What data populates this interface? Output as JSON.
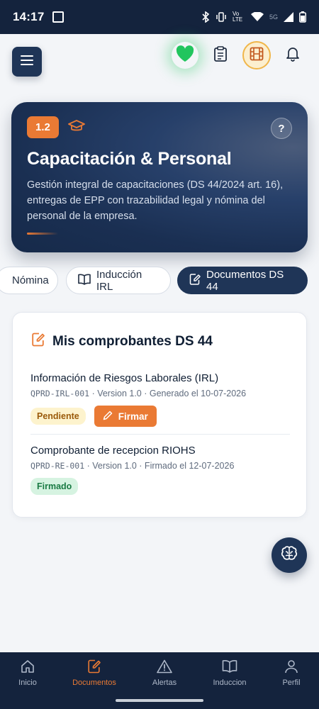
{
  "status_bar": {
    "time": "14:17",
    "network_labels": [
      "Vo LTE",
      "5G"
    ]
  },
  "hero": {
    "badge": "1.2",
    "help": "?",
    "title": "Capacitación & Personal",
    "description": "Gestión integral de capacitaciones (DS 44/2024 art. 16), entregas de EPP con trazabilidad legal y nómina del personal de la empresa."
  },
  "tabs": [
    {
      "label": "Nómina"
    },
    {
      "label": "Inducción IRL"
    },
    {
      "label": "Documentos DS 44",
      "active": true
    }
  ],
  "card": {
    "title": "Mis comprobantes DS 44",
    "documents": [
      {
        "name": "Información de Riesgos Laborales (IRL)",
        "code": "QPRD-IRL-001",
        "meta": " · Version 1.0 · Generado el 10-07-2026",
        "status": "Pendiente",
        "action": "Firmar"
      },
      {
        "name": "Comprobante de recepcion RIOHS",
        "code": "QPRD-RE-001",
        "meta": " · Version 1.0 · Firmado el 12-07-2026",
        "status": "Firmado"
      }
    ]
  },
  "bottom_nav": [
    {
      "label": "Inicio",
      "icon": "home-icon"
    },
    {
      "label": "Documentos",
      "icon": "document-edit-icon",
      "active": true
    },
    {
      "label": "Alertas",
      "icon": "warning-icon"
    },
    {
      "label": "Induccion",
      "icon": "book-icon"
    },
    {
      "label": "Perfil",
      "icon": "user-icon"
    }
  ],
  "colors": {
    "navy": "#1f3557",
    "status_bar": "#14233d",
    "accent_orange": "#ea7a34",
    "heart_green": "#22c55e",
    "pending_bg": "#fdf3cd",
    "signed_bg": "#d6f3e1"
  }
}
